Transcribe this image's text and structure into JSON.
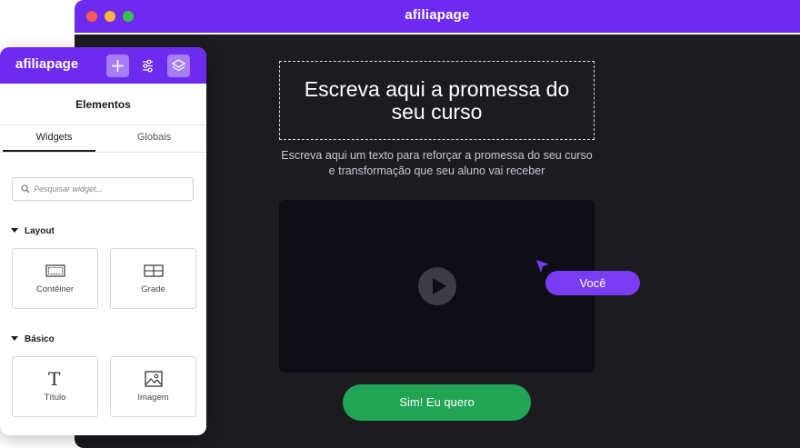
{
  "window": {
    "title": "afiliapage"
  },
  "page": {
    "headline": "Escreva aqui a promessa do seu curso",
    "subtext": "Escreva aqui um texto para reforçar a promessa do seu curso e transformação que seu aluno vai receber",
    "cursor_label": "Você",
    "cta_label": "Sim! Eu quero"
  },
  "editor": {
    "brand": "afiliapage",
    "title": "Elementos",
    "tabs": [
      "Widgets",
      "Globais"
    ],
    "search_placeholder": "Pesquisar widget...",
    "sections": [
      {
        "title": "Layout",
        "items": [
          {
            "label": "Contêiner",
            "icon": "container-icon"
          },
          {
            "label": "Grade",
            "icon": "grid-icon"
          }
        ]
      },
      {
        "title": "Básico",
        "items": [
          {
            "label": "Título",
            "icon": "heading-icon"
          },
          {
            "label": "Imagem",
            "icon": "image-icon"
          }
        ]
      }
    ]
  },
  "colors": {
    "brand": "#6d2bf0",
    "cta": "#22a455",
    "canvas": "#1b1b20",
    "cursor_tag": "#7a3cf2"
  }
}
